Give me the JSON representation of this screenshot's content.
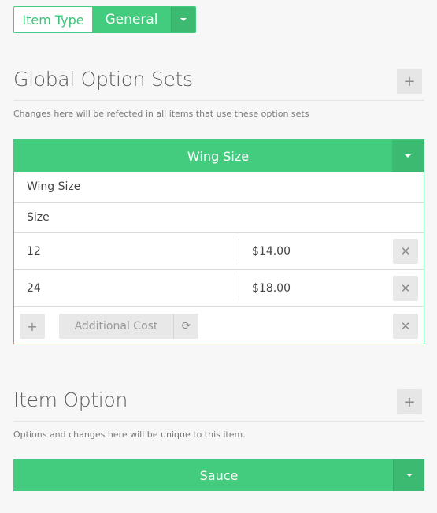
{
  "item_type": {
    "label": "Item Type",
    "value": "General"
  },
  "global_option_sets": {
    "title": "Global Option Sets",
    "add_label": "+",
    "help": "Changes here will be refected in all items that use these option sets",
    "card": {
      "header": "Wing Size",
      "name_field": "Wing Size",
      "size_field": "Size",
      "options": [
        {
          "name": "12",
          "price": "$14.00"
        },
        {
          "name": "24",
          "price": "$18.00"
        }
      ],
      "add_label": "+",
      "additional_cost_label": "Additional Cost"
    }
  },
  "item_option": {
    "title": "Item Option",
    "add_label": "+",
    "help": "Options and changes here will be unique to this item.",
    "option_set": {
      "header": "Sauce"
    }
  },
  "icons": {
    "remove": "close-icon",
    "dropdown": "caret-down-icon",
    "refresh": "refresh-icon"
  },
  "colors": {
    "accent": "#43cb7e",
    "accent_dark": "#3cba72",
    "background": "#f7f7f8"
  }
}
